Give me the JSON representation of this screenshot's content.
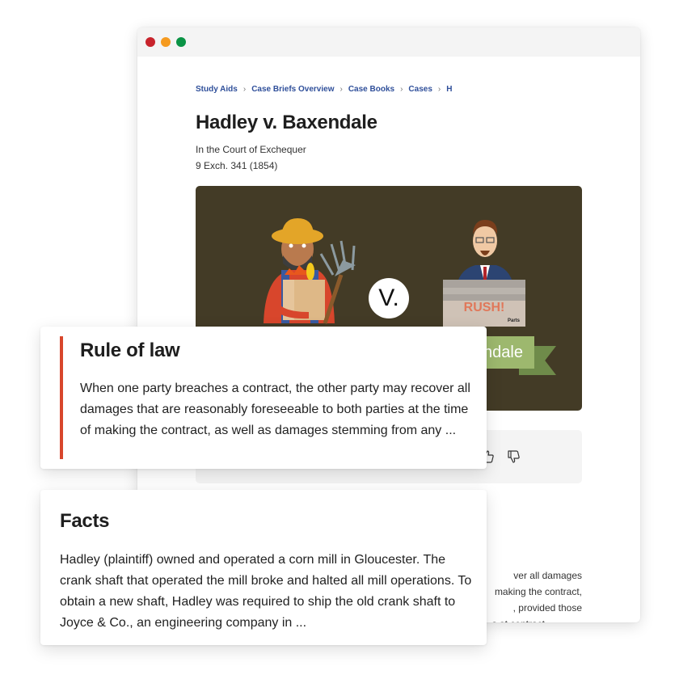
{
  "window": {
    "controls": [
      "close",
      "minimize",
      "maximize"
    ],
    "control_colors": {
      "close": "#c8232c",
      "minimize": "#f59a1f",
      "maximize": "#0a9345"
    }
  },
  "breadcrumb": {
    "items": [
      "Study Aids",
      "Case Briefs Overview",
      "Case Books",
      "Cases",
      "H"
    ],
    "separator": "›"
  },
  "case": {
    "title": "Hadley v. Baxendale",
    "court": "In the Court of Exchequer",
    "citation": "9 Exch. 341 (1854)"
  },
  "hero": {
    "background": "#433b26",
    "vs_label": "V.",
    "ribbon_label": "ndale",
    "box_label": "RUSH!",
    "box_sublabel": "Parts",
    "icons": [
      "farmer-illustration",
      "pitchfork-icon",
      "businessman-illustration",
      "shipping-box-icon"
    ]
  },
  "feedback": {
    "up_icon": "thumbs-up-icon",
    "down_icon": "thumbs-down-icon"
  },
  "summary_snippet": {
    "lines": [
      "ver all damages",
      "making the contract,",
      ", provided those",
      "s at contract"
    ]
  },
  "rule_of_law": {
    "title": "Rule of law",
    "body": "When one party breaches a contract, the other party may recover all damages that are reasonably foreseeable to both parties at the time of making the contract, as well as damages stemming from any ...",
    "accent_color": "#d8462c"
  },
  "facts": {
    "title": "Facts",
    "body": "Hadley (plaintiff) owned and operated a corn mill in Gloucester. The crank shaft that operated the mill broke and halted all mill operations. To obtain a new shaft, Hadley was required to ship the old crank shaft to Joyce & Co., an engineering company in ..."
  }
}
